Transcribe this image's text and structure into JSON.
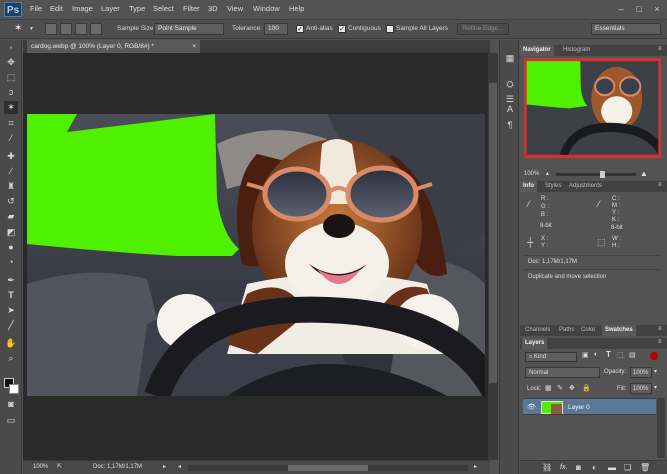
{
  "app": {
    "logo": "Ps"
  },
  "menu": [
    "File",
    "Edit",
    "Image",
    "Layer",
    "Type",
    "Select",
    "Filter",
    "3D",
    "View",
    "Window",
    "Help"
  ],
  "window_controls": [
    "–",
    "□",
    "×"
  ],
  "options": {
    "sample_size_label": "Sample Size:",
    "sample_size_value": "Point Sample",
    "tolerance_label": "Tolerance:",
    "tolerance_value": "100",
    "anti_alias": "Anti-alias",
    "contiguous": "Contiguous",
    "sample_all_layers": "Sample All Layers",
    "refine_edge": "Refine Edge...",
    "workspace": "Essentials"
  },
  "document": {
    "tab_title": "cardog.webp @ 100% (Layer 0, RGB/8#) *",
    "close": "×"
  },
  "status": {
    "zoom": "100%",
    "doc": "Doc: 1,17M/1,17M"
  },
  "navigator": {
    "tabs": [
      "Navigator",
      "Histogram"
    ],
    "zoom": "100%"
  },
  "info": {
    "tabs": [
      "Info",
      "Styles",
      "Adjustments"
    ],
    "rgb_labels": [
      "R :",
      "G :",
      "B :"
    ],
    "cmyk_labels": [
      "C :",
      "M :",
      "Y :",
      "K :"
    ],
    "bit_left": "8-bit",
    "bit_right": "8-bit",
    "xy_labels": [
      "X :",
      "Y :"
    ],
    "wh_labels": [
      "W :",
      "H :"
    ],
    "doc": "Doc: 1,17M/1,17M",
    "hint": "Duplicate and move selection"
  },
  "lower_tabs": [
    "Channels",
    "Paths",
    "Color",
    "Swatches"
  ],
  "layers": {
    "tab": "Layers",
    "kind": "Kind",
    "blend_mode": "Normal",
    "opacity_label": "Opacity:",
    "opacity_value": "100%",
    "lock_label": "Lock:",
    "fill_label": "Fill:",
    "fill_value": "100%",
    "layer_name": "Layer 0"
  },
  "colors": {
    "chroma_green": "#4ff000",
    "selection_blue": "#5a7796",
    "nav_frame": "#d23232"
  }
}
